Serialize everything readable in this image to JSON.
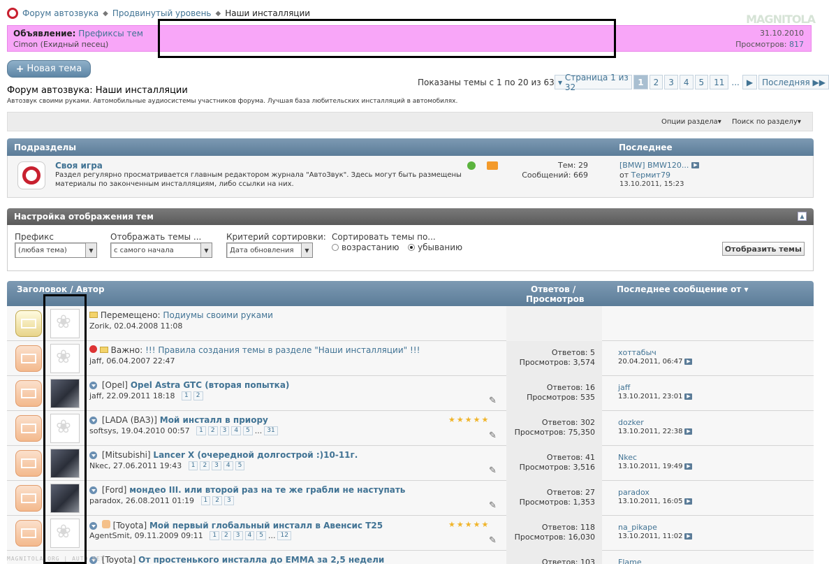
{
  "breadcrumb": {
    "items": [
      "Форум автозвука",
      "Продвинутый уровень",
      "Наши инсталляции"
    ]
  },
  "watermark": "MAGNITOLA",
  "announcement": {
    "label": "Объявление:",
    "title": "Префиксы тем",
    "author": "Cimon (Ехидный песец)",
    "date": "31.10.2010",
    "views_label": "Просмотров:",
    "views": "817"
  },
  "new_topic": "Новая тема",
  "shown_text": "Показаны темы с 1 по 20 из 632",
  "pager": {
    "label": "Страница 1 из 32",
    "pages": [
      "1",
      "2",
      "3",
      "4",
      "5",
      "11"
    ],
    "ellipsis": "...",
    "last": "Последняя"
  },
  "forum": {
    "title": "Форум автозвука: Наши инсталляции",
    "description": "Автозвук своими руками. Автомобильные аудиосистемы участников форума. Лучшая база любительских инсталляций в автомобилях."
  },
  "options": {
    "section": "Опции раздела",
    "search": "Поиск по разделу"
  },
  "subforums": {
    "header": "Подразделы",
    "header_last": "Последнее",
    "item": {
      "title": "Своя игра",
      "desc1": "Раздел регулярно просматривается главным редактором журнала \"АвтоЗвук\". Здесь могут быть размещены",
      "desc2": "материалы по законченным инсталляциям, либо ссылки на них.",
      "themes": "Тем: 29",
      "messages": "Сообщений: 669",
      "last_title": "[BMW] BMW120...",
      "last_from": "от",
      "last_user": "Термит79",
      "last_date": "13.10.2011, 15:23"
    }
  },
  "display": {
    "header": "Настройка отображения тем",
    "prefix_label": "Префикс",
    "prefix_value": "(любая тема)",
    "show_label": "Отображать темы ...",
    "show_value": "с самого начала",
    "sort_label": "Критерий сортировки:",
    "sort_value": "Дата обновления",
    "order_label": "Сортировать темы по...",
    "asc": "возрастанию",
    "desc": "убыванию",
    "button": "Отобразить темы"
  },
  "threads": {
    "col_title": "Заголовок / Автор",
    "col_stats1": "Ответов /",
    "col_stats2": "Просмотров",
    "col_last": "Последнее сообщение от",
    "rows": [
      {
        "prefix": "Перемещено:",
        "title": "Подиумы своими руками",
        "author": "Zorik, 02.04.2008 11:08",
        "pages": [],
        "replies": "",
        "views": "",
        "last_user": "",
        "last_date": ""
      },
      {
        "prefix": "Важно:",
        "title": "!!! Правила создания темы в разделе \"Наши инсталляции\" !!!",
        "author": "jaff, 06.04.2007 22:47",
        "pages": [],
        "replies": "Ответов: 5",
        "views": "Просмотров: 3,574",
        "last_user": "хоттабыч",
        "last_date": "20.04.2011, 06:47"
      },
      {
        "prefix": "[Opel]",
        "title": "Opel Astra GTC (вторая попытка)",
        "author": "jaff, 22.09.2011 18:18",
        "pages": [
          "1",
          "2"
        ],
        "replies": "Ответов: 16",
        "views": "Просмотров: 535",
        "last_user": "jaff",
        "last_date": "13.10.2011, 23:01"
      },
      {
        "prefix": "[LADA (ВАЗ)]",
        "title": "Мой инсталл в приору",
        "author": "softsys, 19.04.2010 00:57",
        "pages": [
          "1",
          "2",
          "3",
          "4",
          "5",
          "...",
          "31"
        ],
        "replies": "Ответов: 302",
        "views": "Просмотров: 75,350",
        "last_user": "dozker",
        "last_date": "13.10.2011, 22:38"
      },
      {
        "prefix": "[Mitsubishi]",
        "title": "Lancer X (очередной долгострой :)10-11г.",
        "author": "Nkec, 27.06.2011 19:43",
        "pages": [
          "1",
          "2",
          "3",
          "4",
          "5"
        ],
        "replies": "Ответов: 41",
        "views": "Просмотров: 3,516",
        "last_user": "Nkec",
        "last_date": "13.10.2011, 19:49"
      },
      {
        "prefix": "[Ford]",
        "title": "мондео III. или второй раз на те же грабли не наступать",
        "author": "paradox, 26.08.2011 01:19",
        "pages": [
          "1",
          "2",
          "3"
        ],
        "replies": "Ответов: 27",
        "views": "Просмотров: 1,353",
        "last_user": "paradox",
        "last_date": "13.10.2011, 16:05"
      },
      {
        "prefix": "[Toyota]",
        "title": "Мой первый глобальный инсталл в Авенсис Т25",
        "author": "AgentSmit, 09.11.2009 09:11",
        "pages": [
          "1",
          "2",
          "3",
          "4",
          "5",
          "...",
          "12"
        ],
        "replies": "Ответов: 118",
        "views": "Просмотров: 16,030",
        "last_user": "na_pikape",
        "last_date": "13.10.2011, 11:02"
      },
      {
        "prefix": "[Toyota]",
        "title": "От простенького инсталла до EMMA за 2,5 недели",
        "author": "",
        "pages": [],
        "replies": "Ответов: 103",
        "views": "",
        "last_user": "Flame",
        "last_date": ""
      }
    ]
  },
  "footer_watermark": "MAGNITOLA.ORG | AUTO.NET"
}
